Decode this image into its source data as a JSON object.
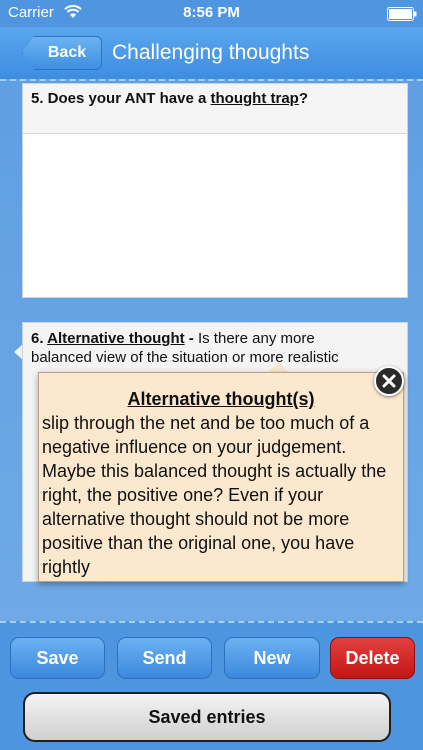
{
  "status": {
    "carrier": "Carrier",
    "time": "8:56 PM"
  },
  "nav": {
    "back_label": "Back",
    "title": "Challenging thoughts"
  },
  "q5": {
    "prefix": "5. Does your ANT have a ",
    "link": "thought trap",
    "suffix": "?"
  },
  "q6": {
    "num": "6. ",
    "link": "Alternative thought",
    "dash": " - ",
    "text_line1": "Is there any more",
    "text_line2": "balanced view of the situation or more realistic"
  },
  "popover": {
    "title": "Alternative thought(s)",
    "body": "slip through the net and be too much of a negative influence on your judgement. Maybe this balanced thought is actually the right, the positive one? Even if your alternative thought should not be more positive than the original one, you have rightly"
  },
  "toolbar": {
    "save": "Save",
    "send": "Send",
    "new": "New",
    "delete": "Delete",
    "saved_entries": "Saved entries"
  },
  "icons": {
    "wifi": "wifi-icon",
    "battery": "battery-icon",
    "close": "close-icon"
  },
  "colors": {
    "accent": "#4f95e0",
    "delete": "#d42a2a",
    "popover_bg": "#fbe8cf"
  }
}
